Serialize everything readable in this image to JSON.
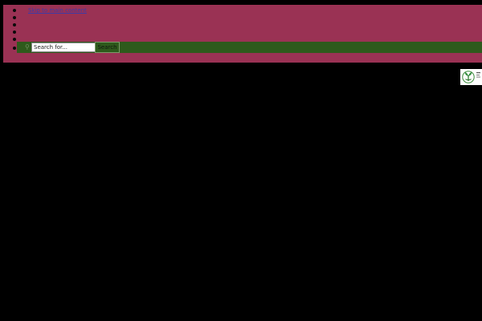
{
  "nav": {
    "skip_link": "Skip to main content"
  },
  "search": {
    "placeholder": "Search for...",
    "button_label": "Search",
    "icon": "search-icon"
  },
  "logo": {
    "icon": "emblem-logo"
  },
  "colors": {
    "page_background": "#000000",
    "header_band": "#9a3254",
    "search_bar": "#2e5a1c",
    "link": "#3b3ba8"
  }
}
